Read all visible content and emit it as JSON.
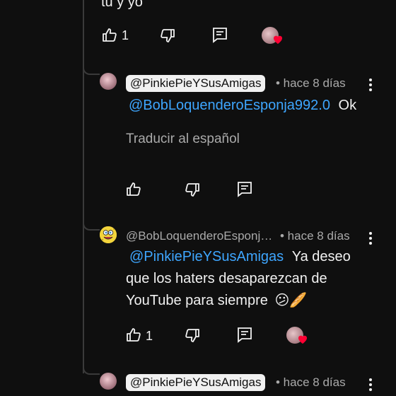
{
  "top_comment": {
    "text_tail": "tu y yo",
    "like_count": "1"
  },
  "replies": [
    {
      "handle": "@PinkiePieYSusAmigas",
      "time": "• hace 8 días",
      "mention": "@BobLoquenderoEsponja992.0",
      "text": "Ok",
      "translate_label": "Traducir al español"
    },
    {
      "handle": "@BobLoquenderoEsponj…",
      "time": "• hace 8 días",
      "mention": "@PinkiePieYSusAmigas",
      "line1": "Ya deseo",
      "line2": "que los haters desaparezcan de",
      "line3": "YouTube para siempre",
      "emoji": "😕🥖",
      "like_count": "1"
    },
    {
      "handle": "@PinkiePieYSusAmigas",
      "time": "• hace 8 días"
    }
  ],
  "colors": {
    "background": "#0f0f0f",
    "mention": "#3ea6ff",
    "heart": "#ff0033"
  },
  "icons": [
    "like-icon",
    "dislike-icon",
    "reply-icon",
    "creator-heart-icon",
    "more-options-icon"
  ]
}
